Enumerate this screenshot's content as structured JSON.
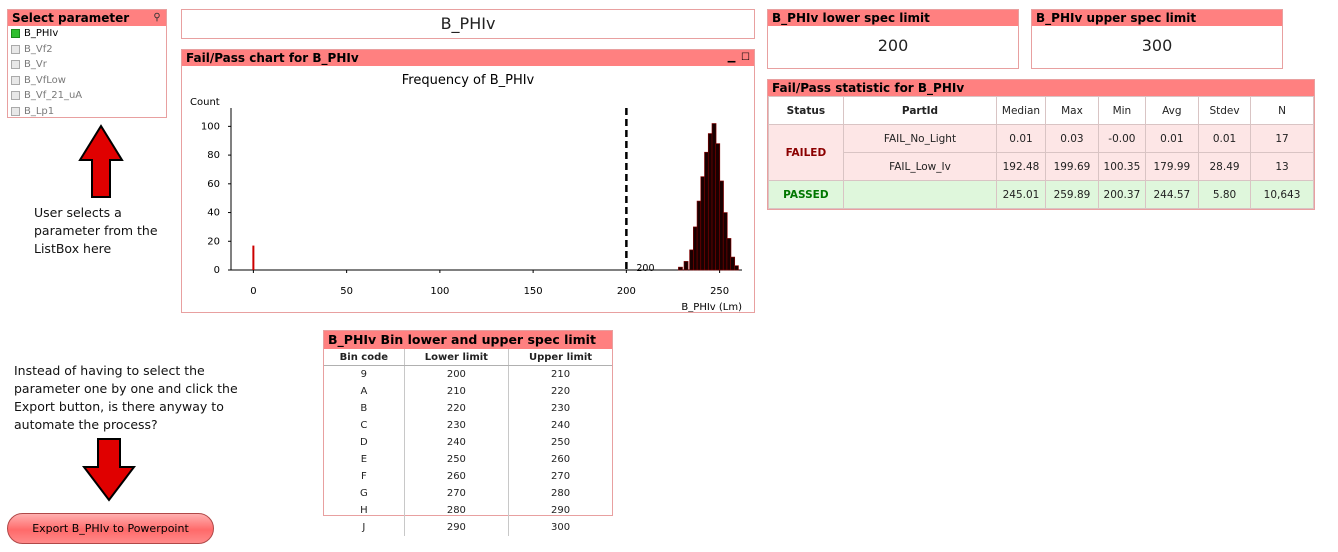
{
  "listbox": {
    "title": "Select parameter",
    "items": [
      {
        "label": "B_PHIv",
        "selected": true
      },
      {
        "label": "B_Vf2",
        "selected": false
      },
      {
        "label": "B_Vr",
        "selected": false
      },
      {
        "label": "B_VfLow",
        "selected": false
      },
      {
        "label": "B_Vf_21_uA",
        "selected": false
      },
      {
        "label": "B_Lp1",
        "selected": false
      }
    ]
  },
  "selected_param": "B_PHIv",
  "lower_spec": {
    "title": "B_PHIv lower spec limit",
    "value": "200"
  },
  "upper_spec": {
    "title": "B_PHIv upper spec limit",
    "value": "300"
  },
  "chart_panel": {
    "title": "Fail/Pass chart for B_PHIv"
  },
  "chart_data": {
    "type": "bar",
    "title": "Frequency of B_PHIv",
    "ylabel": "Count",
    "xlabel": "B_PHIv (Lm)",
    "xticks": [
      0,
      50,
      100,
      150,
      200,
      250
    ],
    "yticks": [
      0,
      20,
      40,
      60,
      80,
      100
    ],
    "xlim": [
      -12,
      262
    ],
    "ylim": [
      0,
      110
    ],
    "spec_line": {
      "x": 200,
      "label": "200"
    },
    "series": [
      {
        "x": [
          0
        ],
        "values": [
          17
        ],
        "color": "#cc0000"
      },
      {
        "x": [
          229,
          232,
          235,
          237,
          239,
          241,
          243,
          245,
          247,
          249,
          251,
          253,
          255,
          257,
          259
        ],
        "values": [
          2,
          6,
          14,
          30,
          48,
          65,
          82,
          95,
          102,
          88,
          62,
          40,
          22,
          9,
          3
        ],
        "color": "#1a0000"
      }
    ]
  },
  "stat_panel": {
    "title": "Fail/Pass statistic for B_PHIv",
    "headers": [
      "Status",
      "PartId",
      "Median",
      "Max",
      "Min",
      "Avg",
      "Stdev",
      "N"
    ],
    "rows": [
      {
        "status": "FAILED",
        "partid": "FAIL_No_Light",
        "values": [
          "0.01",
          "0.03",
          "-0.00",
          "0.01",
          "0.01",
          "17"
        ]
      },
      {
        "status": "",
        "partid": "FAIL_Low_Iv",
        "values": [
          "192.48",
          "199.69",
          "100.35",
          "179.99",
          "28.49",
          "13"
        ]
      },
      {
        "status": "PASSED",
        "partid": "",
        "values": [
          "245.01",
          "259.89",
          "200.37",
          "244.57",
          "5.80",
          "10,643"
        ]
      }
    ]
  },
  "bin_panel": {
    "title": "B_PHIv Bin lower and upper spec limit",
    "headers": [
      "Bin code",
      "Lower limit",
      "Upper limit"
    ],
    "rows": [
      [
        "9",
        "200",
        "210"
      ],
      [
        "A",
        "210",
        "220"
      ],
      [
        "B",
        "220",
        "230"
      ],
      [
        "C",
        "230",
        "240"
      ],
      [
        "D",
        "240",
        "250"
      ],
      [
        "E",
        "250",
        "260"
      ],
      [
        "F",
        "260",
        "270"
      ],
      [
        "G",
        "270",
        "280"
      ],
      [
        "H",
        "280",
        "290"
      ],
      [
        "J",
        "290",
        "300"
      ]
    ]
  },
  "notes": {
    "listbox_note": [
      "User selects a",
      "parameter from the",
      "ListBox here"
    ],
    "automate_note": [
      "Instead of having to select the",
      "parameter one by one and click the",
      "Export button, is there anyway to",
      "automate the process?"
    ]
  },
  "export_button": {
    "label": "Export B_PHIv to Powerpoint"
  },
  "colors": {
    "caption": "#ff8080",
    "arrow": "#e00000",
    "failed_bg": "#fde6e6",
    "passed_bg": "#dff7dc"
  }
}
